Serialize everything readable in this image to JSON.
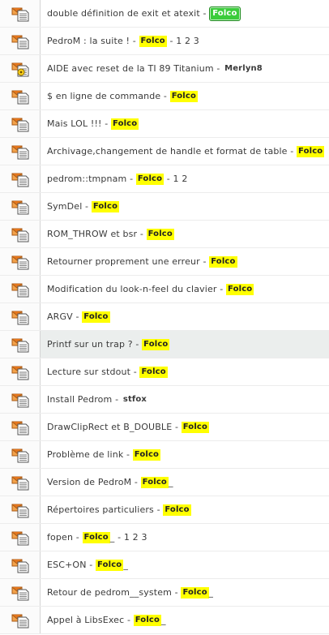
{
  "colors": {
    "highlight_author": "#ffff00",
    "moderator_author": "#3bcc3b",
    "row_highlight": "#ebeeed"
  },
  "topics": [
    {
      "title": "double définition de exit et atexit",
      "author": "Folco",
      "style": "green",
      "suffix": "",
      "pages": "",
      "icon": "message-icon"
    },
    {
      "title": "PedroM : la suite !",
      "author": "Folco",
      "style": "yellow",
      "suffix": "",
      "pages": "1 2 3",
      "icon": "message-icon"
    },
    {
      "title": "AIDE avec reset de la TI 89 Titanium",
      "author": "Merlyn8",
      "style": "plain",
      "suffix": "",
      "pages": "",
      "icon": "message-new-icon"
    },
    {
      "title": "$ en ligne de commande",
      "author": "Folco",
      "style": "yellow",
      "suffix": "",
      "pages": "",
      "icon": "message-icon"
    },
    {
      "title": "Mais LOL !!!",
      "author": "Folco",
      "style": "yellow",
      "suffix": "",
      "pages": "",
      "icon": "message-icon"
    },
    {
      "title": "Archivage,changement de handle et format de table",
      "author": "Folco",
      "style": "yellow",
      "suffix": "",
      "pages": "",
      "icon": "message-icon"
    },
    {
      "title": "pedrom::tmpnam",
      "author": "Folco",
      "style": "yellow",
      "suffix": "",
      "pages": "1 2",
      "icon": "message-icon"
    },
    {
      "title": "SymDel",
      "author": "Folco",
      "style": "yellow",
      "suffix": "",
      "pages": "",
      "icon": "message-icon"
    },
    {
      "title": "ROM_THROW et bsr",
      "author": "Folco",
      "style": "yellow",
      "suffix": "",
      "pages": "",
      "icon": "message-icon"
    },
    {
      "title": "Retourner proprement une erreur",
      "author": "Folco",
      "style": "yellow",
      "suffix": "",
      "pages": "",
      "icon": "message-icon"
    },
    {
      "title": "Modification du look-n-feel du clavier",
      "author": "Folco",
      "style": "yellow",
      "suffix": "",
      "pages": "",
      "icon": "message-icon"
    },
    {
      "title": "ARGV",
      "author": "Folco",
      "style": "yellow",
      "suffix": "",
      "pages": "",
      "icon": "message-icon"
    },
    {
      "title": "Printf sur un trap ?",
      "author": "Folco",
      "style": "yellow",
      "suffix": "",
      "pages": "",
      "icon": "message-icon",
      "highlighted": true
    },
    {
      "title": "Lecture sur stdout",
      "author": "Folco",
      "style": "yellow",
      "suffix": "",
      "pages": "",
      "icon": "message-icon"
    },
    {
      "title": "Install Pedrom",
      "author": "stfox",
      "style": "plain",
      "suffix": "",
      "pages": "",
      "icon": "message-icon"
    },
    {
      "title": "DrawClipRect et B_DOUBLE",
      "author": "Folco",
      "style": "yellow",
      "suffix": "",
      "pages": "",
      "icon": "message-icon"
    },
    {
      "title": "Problème de link",
      "author": "Folco",
      "style": "yellow",
      "suffix": "",
      "pages": "",
      "icon": "message-icon"
    },
    {
      "title": "Version de PedroM",
      "author": "Folco",
      "style": "yellow",
      "suffix": "_",
      "pages": "",
      "icon": "message-icon"
    },
    {
      "title": "Répertoires particuliers",
      "author": "Folco",
      "style": "yellow",
      "suffix": "",
      "pages": "",
      "icon": "message-icon"
    },
    {
      "title": "fopen",
      "author": "Folco",
      "style": "yellow",
      "suffix": "_",
      "pages": "1 2 3",
      "icon": "message-icon"
    },
    {
      "title": "ESC+ON",
      "author": "Folco",
      "style": "yellow",
      "suffix": "_",
      "pages": "",
      "icon": "message-icon"
    },
    {
      "title": "Retour de pedrom__system",
      "author": "Folco",
      "style": "yellow",
      "suffix": "_",
      "pages": "",
      "icon": "message-icon"
    },
    {
      "title": "Appel à LibsExec",
      "author": "Folco",
      "style": "yellow",
      "suffix": "_",
      "pages": "",
      "icon": "message-icon"
    }
  ]
}
